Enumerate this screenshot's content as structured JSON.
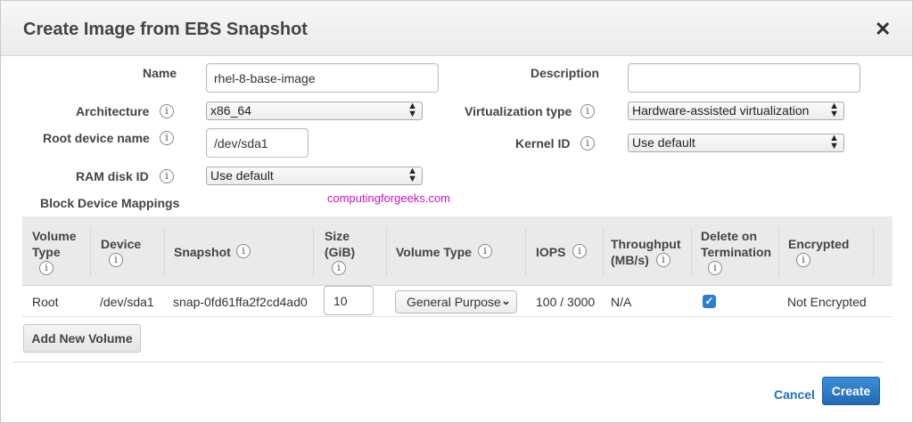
{
  "dialog": {
    "title": "Create Image from EBS Snapshot",
    "close_glyph": "✕"
  },
  "form": {
    "name_label": "Name",
    "name_value": "rhel-8-base-image",
    "description_label": "Description",
    "description_value": "",
    "architecture_label": "Architecture",
    "architecture_value": "x86_64",
    "virtualization_label": "Virtualization type",
    "virtualization_value": "Hardware-assisted virtualization",
    "root_device_label": "Root device name",
    "root_device_value": "/dev/sda1",
    "kernel_label": "Kernel ID",
    "kernel_value": "Use default",
    "ramdisk_label": "RAM disk ID",
    "ramdisk_value": "Use default",
    "info_glyph": "i"
  },
  "block_device": {
    "heading": "Block Device Mappings",
    "watermark": "computingforgeeks.com",
    "columns": {
      "volume_type_1": "Volume",
      "volume_type_2": "Type",
      "device": "Device",
      "snapshot": "Snapshot",
      "size_1": "Size",
      "size_2": "(GiB)",
      "volume_type": "Volume Type",
      "iops": "IOPS",
      "throughput_1": "Throughput",
      "throughput_2": "(MB/s)",
      "delete_1": "Delete on",
      "delete_2": "Termination",
      "encrypted": "Encrypted"
    },
    "row": {
      "volume_type": "Root",
      "device": "/dev/sda1",
      "snapshot": "snap-0fd61ffa2f2cd4ad0",
      "size": "10",
      "vol_type_select": "General Purpose",
      "iops": "100 / 3000",
      "throughput": "N/A",
      "delete_on_termination": true,
      "encrypted": "Not Encrypted"
    },
    "add_volume_label": "Add New Volume"
  },
  "footer": {
    "cancel_label": "Cancel",
    "create_label": "Create"
  },
  "colors": {
    "accent": "#2a7fd4",
    "link": "#1f6fbe",
    "watermark": "#c716c7"
  }
}
